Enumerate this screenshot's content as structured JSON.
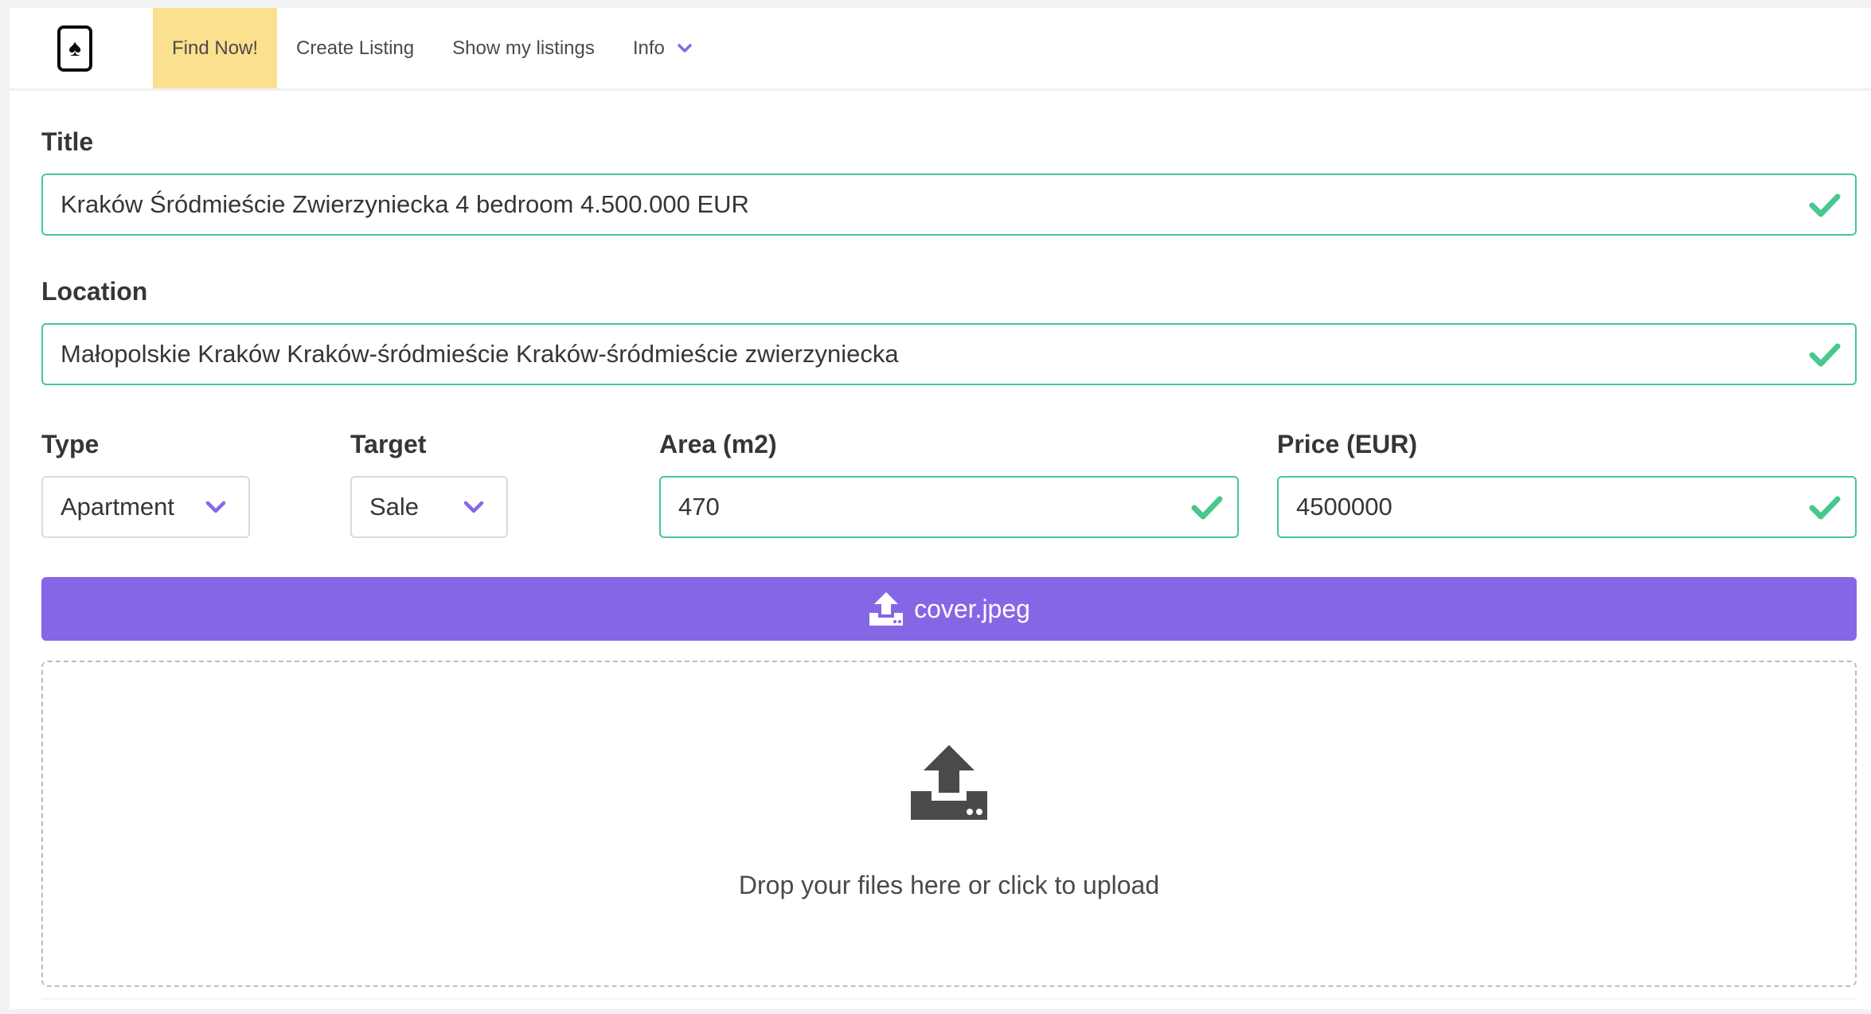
{
  "nav": {
    "brand_icon": "spade-card-icon",
    "items": [
      {
        "label": "Find Now!",
        "active": true
      },
      {
        "label": "Create Listing",
        "active": false
      },
      {
        "label": "Show my listings",
        "active": false
      },
      {
        "label": "Info",
        "active": false,
        "has_dropdown": true
      }
    ]
  },
  "form": {
    "title": {
      "label": "Title",
      "value": "Kraków Śródmieście Zwierzyniecka 4 bedroom 4.500.000 EUR"
    },
    "location": {
      "label": "Location",
      "value": "Małopolskie Kraków Kraków-śródmieście Kraków-śródmieście zwierzyniecka"
    },
    "type": {
      "label": "Type",
      "value": "Apartment"
    },
    "target": {
      "label": "Target",
      "value": "Sale"
    },
    "area": {
      "label": "Area (m2)",
      "value": "470"
    },
    "price": {
      "label": "Price (EUR)",
      "value": "4500000"
    }
  },
  "upload": {
    "button_label": "cover.jpeg",
    "dropzone_text": "Drop your files here or click to upload"
  },
  "colors": {
    "accent": "#8567e6",
    "active_nav": "#fbe08f",
    "valid": "#48c78e"
  }
}
